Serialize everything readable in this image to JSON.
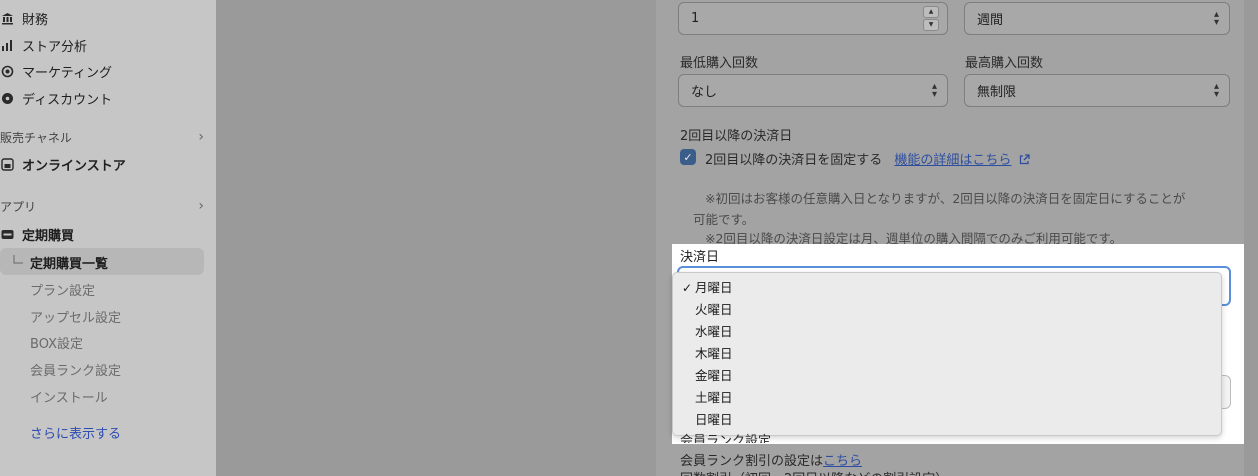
{
  "sidebar": {
    "items": [
      {
        "icon": "bank-icon",
        "label": "財務"
      },
      {
        "icon": "bar-chart-icon",
        "label": "ストア分析"
      },
      {
        "icon": "target-icon",
        "label": "マーケティング"
      },
      {
        "icon": "discount-gear-icon",
        "label": "ディスカウント"
      }
    ],
    "sales_channel_label": "販売チャネル",
    "online_store_label": "オンラインストア",
    "apps_label": "アプリ",
    "app_name": "定期購買",
    "app_sub_active": "定期購買一覧",
    "app_subitems": [
      "プラン設定",
      "アップセル設定",
      "BOX設定",
      "会員ランク設定",
      "インストール"
    ],
    "more_label": "さらに表示する",
    "chevron": "›"
  },
  "form": {
    "interval_value": "1",
    "interval_unit": "週間",
    "min_purchases_label": "最低購入回数",
    "max_purchases_label": "最高購入回数",
    "min_purchases_value": "なし",
    "max_purchases_value": "無制限",
    "second_payment_heading": "2回目以降の決済日",
    "fix_checkbox_label": "2回目以降の決済日を固定する",
    "details_link": "機能の詳細はこちら",
    "note_line1": "※初回はお客様の任意購入日となりますが、2回目以降の決済日を固定日にすることが",
    "note_line2": "可能です。",
    "note_line3": "※2回目以降の決済日設定は月、週単位の購入間隔でのみご利用可能です。",
    "payment_day_label": "決済日",
    "payment_day_options": [
      "月曜日",
      "火曜日",
      "水曜日",
      "木曜日",
      "金曜日",
      "土曜日",
      "日曜日"
    ],
    "payment_day_selected": "月曜日",
    "member_rank_heading": "会員ランク設定",
    "member_rank_text": "会員ランク割引の設定は",
    "member_rank_link": "こちら",
    "count_discount_text": "回数割引（初回・2回目以降などの割引設定）"
  }
}
